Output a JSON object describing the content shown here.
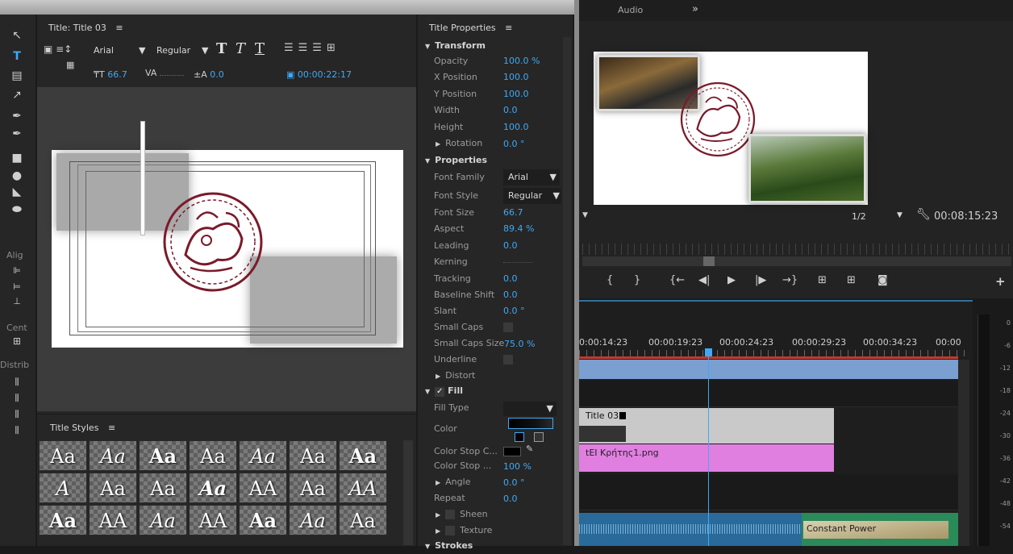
{
  "title_panel": {
    "tab_title": "Title: Title 03",
    "menu_glyph": "≡",
    "font_family": "Arial",
    "font_style": "Regular",
    "font_size": "66.7",
    "kerning": "",
    "leading": "0.0",
    "timecode": "00:00:22:17"
  },
  "left_tools": {
    "align_label": "Alig",
    "center_label": "Cent",
    "distribute_label": "Distrib"
  },
  "title_styles": {
    "label": "Title Styles",
    "menu_glyph": "≡",
    "swatches": [
      "Aa",
      "Aa",
      "Aa",
      "Aa",
      "Aa",
      "Aa",
      "Aa",
      "A",
      "Aa",
      "Aa",
      "Aa",
      "AA",
      "Aa",
      "AA",
      "Aa",
      "AA",
      "Aa",
      "AA",
      "Aa",
      "Aa",
      "Aa"
    ]
  },
  "properties": {
    "header": "Title Properties",
    "menu_glyph": "≡",
    "transform_label": "Transform",
    "transform": [
      {
        "label": "Opacity",
        "value": "100.0 %"
      },
      {
        "label": "X Position",
        "value": "100.0"
      },
      {
        "label": "Y Position",
        "value": "100.0"
      },
      {
        "label": "Width",
        "value": "0.0"
      },
      {
        "label": "Height",
        "value": "100.0"
      }
    ],
    "rotation_label": "Rotation",
    "rotation_value": "0.0 °",
    "properties_label": "Properties",
    "font_family_label": "Font Family",
    "font_family_value": "Arial",
    "font_style_label": "Font Style",
    "font_style_value": "Regular",
    "props": [
      {
        "label": "Font Size",
        "value": "66.7"
      },
      {
        "label": "Aspect",
        "value": "89.4 %"
      },
      {
        "label": "Leading",
        "value": "0.0"
      },
      {
        "label": "Kerning",
        "value": ""
      },
      {
        "label": "Tracking",
        "value": "0.0"
      },
      {
        "label": "Baseline Shift",
        "value": "0.0"
      },
      {
        "label": "Slant",
        "value": "0.0 °"
      }
    ],
    "small_caps_label": "Small Caps",
    "small_caps_size_label": "Small Caps Size",
    "small_caps_size_value": "75.0 %",
    "underline_label": "Underline",
    "distort_label": "Distort",
    "fill_label": "Fill",
    "fill_type_label": "Fill Type",
    "color_label": "Color",
    "color_stop_color_label": "Color Stop C...",
    "color_stop_opacity_label": "Color Stop ...",
    "color_stop_opacity_value": "100 %",
    "angle_label": "Angle",
    "angle_value": "0.0 °",
    "repeat_label": "Repeat",
    "repeat_value": "0.0",
    "sheen_label": "Sheen",
    "texture_label": "Texture",
    "strokes_label": "Strokes"
  },
  "monitor": {
    "tab_audio": "Audio",
    "tab_more": "»",
    "zoom": "1/2",
    "timecode": "00:08:15:23"
  },
  "timeline": {
    "ruler": [
      "0:00:14:23",
      "00:00:19:23",
      "00:00:24:23",
      "00:00:29:23",
      "00:00:34:23",
      "00:00"
    ],
    "clip_title": "Title 03",
    "clip_png": "tEI Κρήτης1.png",
    "transition": "Constant Power"
  },
  "meters": [
    "0",
    "-6",
    "-12",
    "-18",
    "-24",
    "-30",
    "-36",
    "-42",
    "-48",
    "-54"
  ]
}
